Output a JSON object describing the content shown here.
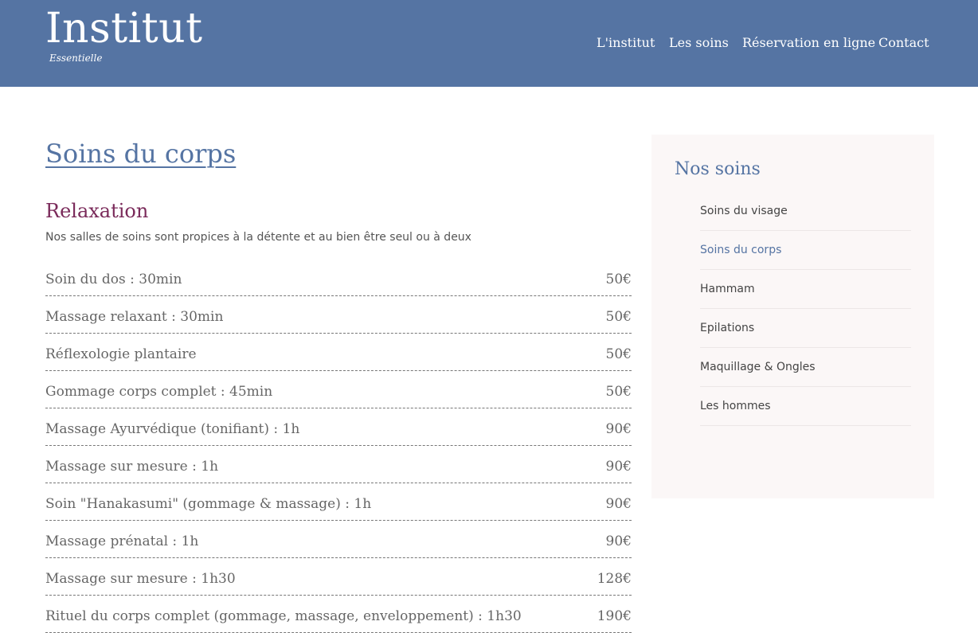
{
  "header": {
    "logo_main": "Institut",
    "logo_sub": "Essentielle",
    "nav": [
      "L'institut",
      "Les soins",
      "Réservation en ligne",
      "Contact"
    ]
  },
  "main": {
    "page_title": "Soins du corps",
    "section_title": "Relaxation",
    "section_desc": "Nos salles de soins sont propices à la détente et au bien être seul ou à deux",
    "items": [
      {
        "name": "Soin du dos : 30min",
        "price": "50€"
      },
      {
        "name": "Massage relaxant : 30min",
        "price": "50€"
      },
      {
        "name": "Réflexologie plantaire",
        "price": "50€"
      },
      {
        "name": "Gommage corps complet : 45min",
        "price": "50€"
      },
      {
        "name": "Massage Ayurvédique (tonifiant) : 1h",
        "price": "90€"
      },
      {
        "name": "Massage sur mesure : 1h",
        "price": "90€"
      },
      {
        "name": "Soin \"Hanakasumi\" (gommage & massage) : 1h",
        "price": "90€"
      },
      {
        "name": "Massage prénatal : 1h",
        "price": "90€"
      },
      {
        "name": "Massage sur mesure : 1h30",
        "price": "128€"
      },
      {
        "name": "Rituel du corps complet (gommage, massage, enveloppement) : 1h30",
        "price": "190€"
      }
    ]
  },
  "sidebar": {
    "title": "Nos soins",
    "items": [
      {
        "label": "Soins du visage"
      },
      {
        "label": "Soins du corps"
      },
      {
        "label": "Hammam"
      },
      {
        "label": "Epilations"
      },
      {
        "label": "Maquillage & Ongles"
      },
      {
        "label": "Les hommes"
      }
    ]
  },
  "colors": {
    "header_bg": "#5574a3",
    "accent_blue": "#5574a3",
    "section_plum": "#7a2a5a",
    "sidebar_bg": "#fbf7f7"
  }
}
